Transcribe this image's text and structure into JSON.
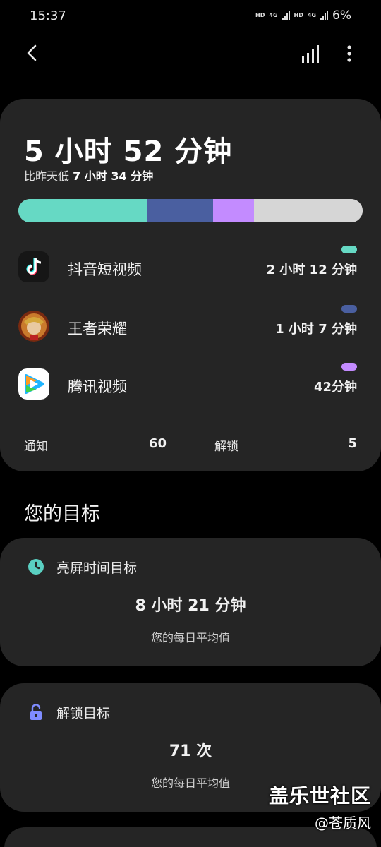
{
  "status_bar": {
    "time": "15:37",
    "net1": "HD",
    "net1_type": "4G",
    "net2": "HD",
    "net2_type": "4G",
    "battery": "6%"
  },
  "summary": {
    "total_time": "5 小时 52 分钟",
    "compare_prefix": "比昨天低 ",
    "compare_value": "7 小时 34 分钟",
    "usage_segments": [
      {
        "app": "抖音短视频",
        "share": 0.375,
        "color": "#66d9c4"
      },
      {
        "app": "王者荣耀",
        "share": 0.19,
        "color": "#4a5fa0"
      },
      {
        "app": "腾讯视频",
        "share": 0.12,
        "color": "#c38bff"
      },
      {
        "app": "其他",
        "share": 0.315,
        "color": "#d6d6d6"
      }
    ],
    "apps": [
      {
        "name": "抖音短视频",
        "time": "2 小时 12 分钟",
        "color": "#66d9c4",
        "icon": "douyin-icon"
      },
      {
        "name": "王者荣耀",
        "time": "1 小时 7 分钟",
        "color": "#4a5fa0",
        "icon": "honor-of-kings-icon"
      },
      {
        "name": "腾讯视频",
        "time": "42分钟",
        "color": "#c38bff",
        "icon": "tencent-video-icon"
      }
    ],
    "notifications_label": "通知",
    "notifications_value": "60",
    "unlocks_label": "解锁",
    "unlocks_value": "5"
  },
  "goals": {
    "section_title": "您的目标",
    "screen_goal": {
      "title": "亮屏时间目标",
      "value": "8 小时 21 分钟",
      "subtitle": "您的每日平均值",
      "icon": "clock-icon",
      "icon_color": "#5ad0c2"
    },
    "unlock_goal": {
      "title": "解锁目标",
      "value": "71 次",
      "subtitle": "您的每日平均值",
      "icon": "unlock-icon",
      "icon_color": "#7f8cff"
    }
  },
  "watermark": {
    "main": "盖乐世社区",
    "sub": "@苍质风"
  }
}
